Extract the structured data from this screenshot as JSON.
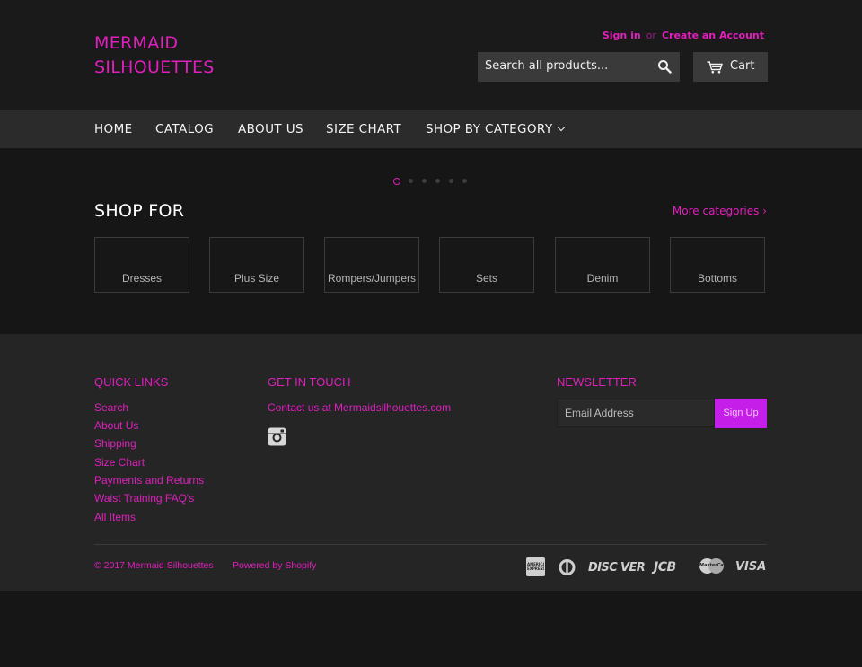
{
  "header": {
    "logo_line1": "MERMAID",
    "logo_line2": "SILHOUETTES",
    "sign_in": "Sign in",
    "or": "or",
    "create_account": "Create an Account",
    "search_placeholder": "Search all products...",
    "cart_label": "Cart"
  },
  "nav": {
    "items": [
      "HOME",
      "CATALOG",
      "ABOUT US",
      "SIZE CHART",
      "SHOP BY CATEGORY"
    ]
  },
  "slideshow": {
    "dot_count": 6,
    "active_index": 0
  },
  "shop_for": {
    "title": "SHOP FOR",
    "more_label": "More categories ›",
    "categories": [
      "Dresses",
      "Plus Size",
      "Rompers/Jumpers",
      "Sets",
      "Denim",
      "Bottoms"
    ]
  },
  "footer": {
    "quick_links_title": "QUICK LINKS",
    "quick_links": [
      "Search",
      "About Us",
      "Shipping",
      "Size Chart",
      "Payments and Returns",
      "Waist Training FAQ's",
      "All Items"
    ],
    "get_in_touch_title": "GET IN TOUCH",
    "contact_text": "Contact us at Mermaidsilhouettes.com",
    "newsletter_title": "NEWSLETTER",
    "email_placeholder": "Email Address",
    "signup_label": "Sign Up",
    "copyright": "© 2017 Mermaid Silhouettes",
    "powered_by": "Powered by Shopify",
    "payment_icons": [
      "american-express",
      "diners-club",
      "discover",
      "jcb",
      "master",
      "visa"
    ],
    "payment_text": {
      "amex": "AMERICAN EXPRESS",
      "discover": "DISC VER",
      "jcb": "JCB",
      "master": "MasterCard",
      "visa": "VISA"
    }
  },
  "colors": {
    "accent": "#e01fbd",
    "signup_button": "#c51ee9",
    "header_bg": "#1a1a1b",
    "nav_bg": "#2b2b2c",
    "footer_bg": "#252526"
  }
}
